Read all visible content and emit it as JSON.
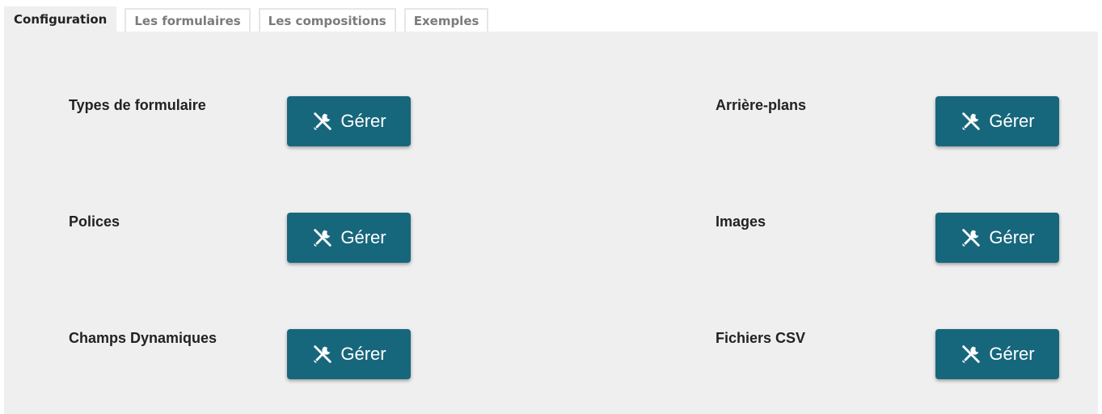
{
  "tabs": [
    {
      "label": "Configuration",
      "active": true
    },
    {
      "label": "Les formulaires",
      "active": false
    },
    {
      "label": "Les compositions",
      "active": false
    },
    {
      "label": "Exemples",
      "active": false
    }
  ],
  "sections": [
    {
      "label": "Types de formulaire",
      "button": "Gérer",
      "icon": "tools-icon"
    },
    {
      "label": "Arrière-plans",
      "button": "Gérer",
      "icon": "tools-icon"
    },
    {
      "label": "Polices",
      "button": "Gérer",
      "icon": "tools-icon"
    },
    {
      "label": "Images",
      "button": "Gérer",
      "icon": "tools-icon"
    },
    {
      "label": "Champs Dynamiques",
      "button": "Gérer",
      "icon": "tools-icon"
    },
    {
      "label": "Fichiers CSV",
      "button": "Gérer",
      "icon": "tools-icon"
    }
  ],
  "colors": {
    "button_bg": "#17677c",
    "panel_bg": "#efefef",
    "tab_inactive_text": "#7b7b7b"
  }
}
